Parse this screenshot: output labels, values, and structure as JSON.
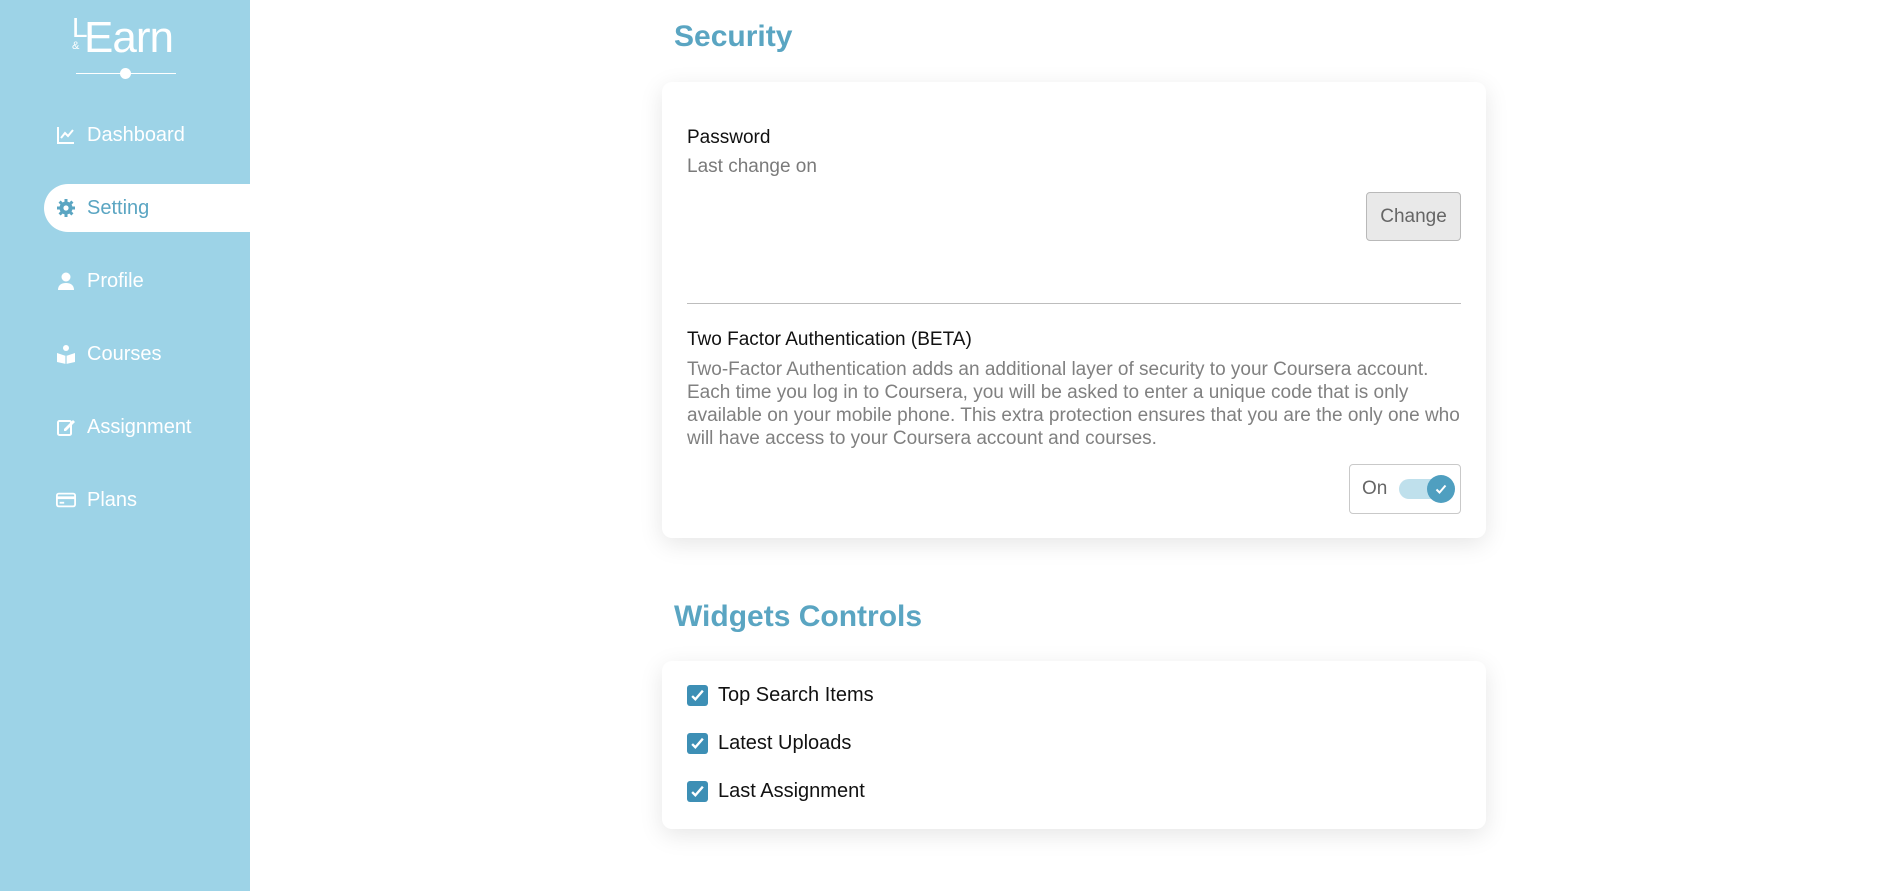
{
  "brand": {
    "logo_l": "L",
    "logo_amp": "&",
    "logo_earn": "Earn"
  },
  "sidebar": {
    "items": [
      {
        "label": "Dashboard",
        "icon": "chart-line-icon"
      },
      {
        "label": "Setting",
        "icon": "gear-icon",
        "active": true
      },
      {
        "label": "Profile",
        "icon": "user-icon"
      },
      {
        "label": "Courses",
        "icon": "book-reader-icon"
      },
      {
        "label": "Assignment",
        "icon": "edit-icon"
      },
      {
        "label": "Plans",
        "icon": "credit-card-icon"
      }
    ]
  },
  "security": {
    "title": "Security",
    "password_label": "Password",
    "password_sub": "Last change on",
    "change_button": "Change",
    "tfa_label": "Two Factor Authentication (BETA)",
    "tfa_description": "Two-Factor Authentication adds an additional layer of security to your Coursera account. Each time you log in to Coursera, you will be asked to enter a unique code that is only available on your mobile phone. This extra protection ensures that you are the only one who will have access to your Coursera account and courses.",
    "tfa_toggle_label": "On",
    "tfa_enabled": true
  },
  "widgets": {
    "title": "Widgets Controls",
    "items": [
      {
        "label": "Top Search Items",
        "checked": true
      },
      {
        "label": "Latest Uploads",
        "checked": true
      },
      {
        "label": "Last Assignment",
        "checked": true
      }
    ]
  },
  "colors": {
    "sidebar": "#9dd3e7",
    "accent": "#5aa5c2",
    "checkbox": "#3d8fb5"
  }
}
